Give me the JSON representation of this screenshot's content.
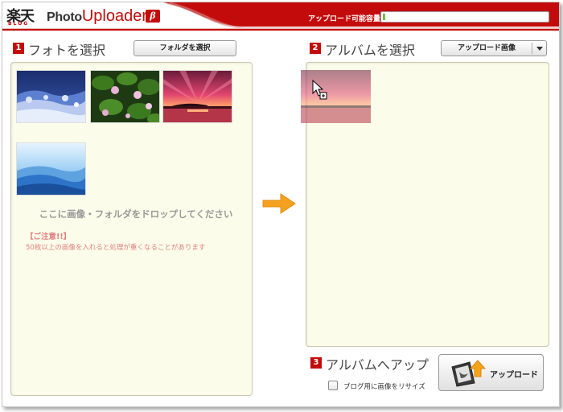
{
  "header": {
    "logo": "楽天",
    "logo_sub": "BLOG",
    "title_part1": "Photo",
    "title_part2": "Uploader",
    "beta": "β",
    "capacity_label": "アップロード可能容量",
    "capacity_fraction": 0.01,
    "colors": {
      "brand_red": "#c40b0b",
      "capacity_fill": "#6cc04a"
    }
  },
  "left": {
    "step": "1",
    "title": "フォトを選択",
    "folder_button": "フォルダを選択",
    "thumbnails": [
      {
        "name": "photo-snowy-trees",
        "icon": "image"
      },
      {
        "name": "photo-water-lilies",
        "icon": "image"
      },
      {
        "name": "photo-sunset",
        "icon": "image"
      },
      {
        "name": "photo-blue-hills",
        "icon": "image"
      }
    ],
    "drop_hint": "ここに画像・フォルダをドロップしてください",
    "caution_title": "【ご注意!!】",
    "caution_text": "50枚以上の画像を入れると処理が重くなることがあります"
  },
  "right": {
    "step": "2",
    "title": "アルバムを選択",
    "album_select": "アップロード画像",
    "dragged_photo": "photo-sunset"
  },
  "upload": {
    "step": "3",
    "title": "アルバムへアップ",
    "button": "アップロード",
    "resize_checked": false,
    "resize_label": "ブログ用に画像をリサイズ"
  }
}
